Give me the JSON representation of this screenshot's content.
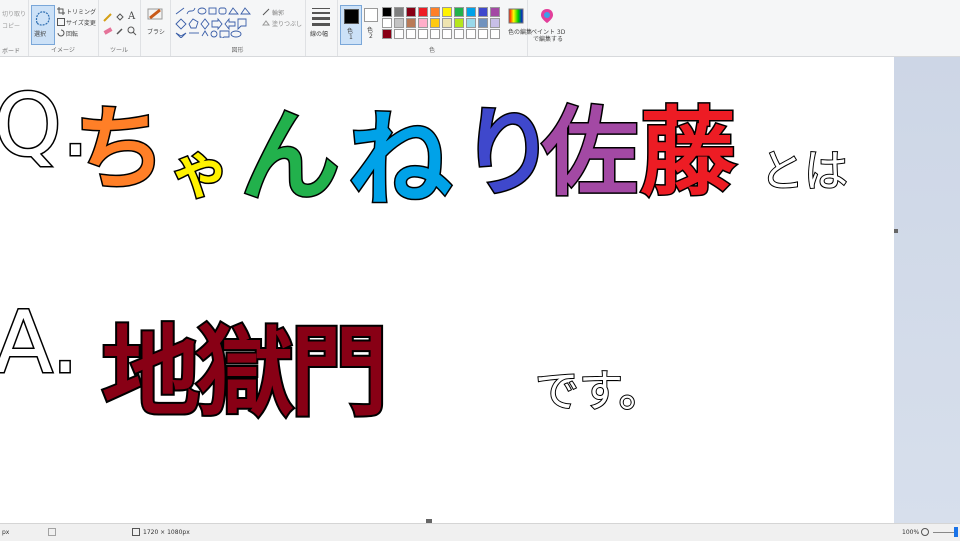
{
  "ribbon": {
    "clipboard": {
      "cut": "切り取り",
      "copy": "コピー",
      "label": "ボード"
    },
    "image": {
      "select": "選択",
      "crop": "トリミング",
      "resize": "サイズ変更",
      "rotate": "回転",
      "label": "イメージ"
    },
    "tools": {
      "text_tool": "A",
      "label": "ツール"
    },
    "brushes": {
      "label": "ブラシ"
    },
    "shapes": {
      "outline": "輪郭",
      "fill": "塗りつぶし",
      "label": "図形"
    },
    "size": {
      "label": "線の幅"
    },
    "colors": {
      "color1_label": "色",
      "color1_num": "1",
      "color2_label": "色",
      "color2_num": "2",
      "edit_colors": "色の編集",
      "paint3d_line1": "ペイント 3D",
      "paint3d_line2": "で編集する",
      "label": "色",
      "color1": "#000000",
      "color2": "#ffffff",
      "palette_row1": [
        "#000000",
        "#7f7f7f",
        "#880015",
        "#ed1c24",
        "#ff7f27",
        "#fff200",
        "#22b14c",
        "#00a2e8",
        "#3f48cc",
        "#a349a4"
      ],
      "palette_row2": [
        "#ffffff",
        "#c3c3c3",
        "#b97a57",
        "#ffaec9",
        "#ffc90e",
        "#efe4b0",
        "#b5e61d",
        "#99d9ea",
        "#7092be",
        "#c8bfe7"
      ],
      "palette_row3": [
        "#880015",
        "#ffffff",
        "#ffffff",
        "#ffffff",
        "#ffffff",
        "#ffffff",
        "#ffffff",
        "#ffffff",
        "#ffffff",
        "#ffffff"
      ]
    }
  },
  "canvas": {
    "line1": {
      "q": "Q.",
      "chars": [
        {
          "t": "ち",
          "color": "#ff7f27"
        },
        {
          "t": "ゃ",
          "color": "#fff200"
        },
        {
          "t": "ん",
          "color": "#22b14c"
        },
        {
          "t": "ね",
          "color": "#00a2e8"
        },
        {
          "t": "り",
          "color": "#3f48cc"
        },
        {
          "t": "佐",
          "color": "#a349a4"
        },
        {
          "t": "藤",
          "color": "#ed1c24"
        }
      ],
      "tail": "とは"
    },
    "line2": {
      "a": "A.",
      "main": "地獄門",
      "main_color": "#880015",
      "tail": "です。"
    }
  },
  "status": {
    "pos": "px",
    "dimensions": "1720 × 1080px",
    "zoom": "100%"
  }
}
